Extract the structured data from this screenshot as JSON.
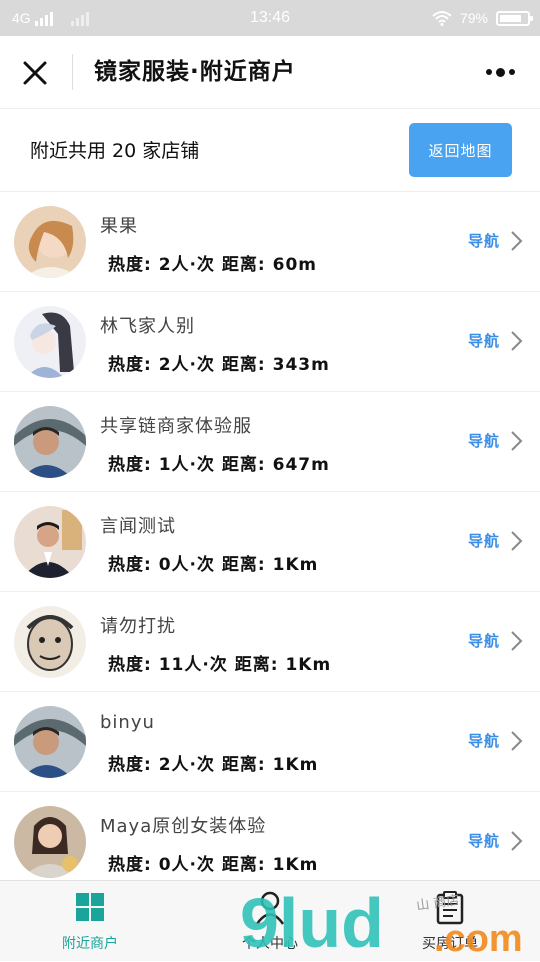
{
  "status_bar": {
    "network": "4G",
    "time": "13:46",
    "battery": "79%",
    "battery_level": 0.79
  },
  "nav": {
    "title": "镜家服装·附近商户"
  },
  "summary": {
    "text": "附近共用 20 家店铺",
    "back_button": "返回地图"
  },
  "merchants": [
    {
      "name": "果果",
      "stats": "热度: 2人·次  距离: 60m",
      "nav_label": "导航",
      "avatar": "avatar-girl"
    },
    {
      "name": "林飞家人别",
      "stats": "热度: 2人·次  距离: 343m",
      "nav_label": "导航",
      "avatar": "avatar-anime"
    },
    {
      "name": "共享链商家体验服",
      "stats": "热度: 1人·次  距离: 647m",
      "nav_label": "导航",
      "avatar": "avatar-man"
    },
    {
      "name": "言闻测试",
      "stats": "热度: 0人·次  距离: 1Km",
      "nav_label": "导航",
      "avatar": "avatar-suit"
    },
    {
      "name": "请勿打扰",
      "stats": "热度: 11人·次  距离: 1Km",
      "nav_label": "导航",
      "avatar": "avatar-cartoon"
    },
    {
      "name": "binyu",
      "stats": "热度: 2人·次  距离: 1Km",
      "nav_label": "导航",
      "avatar": "avatar-man"
    },
    {
      "name": "Maya原创女装体验",
      "stats": "热度: 0人·次  距离: 1Km",
      "nav_label": "导航",
      "avatar": "avatar-woman"
    }
  ],
  "tabs": [
    {
      "label": "附近商户",
      "icon": "grid-icon",
      "active": true
    },
    {
      "label": "个人中心",
      "icon": "person-icon",
      "active": false
    },
    {
      "label": "买房订单",
      "icon": "clipboard-icon",
      "active": false
    }
  ],
  "watermark": {
    "big": "9lud",
    "com": ".com",
    "small": "山 商店"
  },
  "colors": {
    "accent_blue": "#4aa3f0",
    "link_blue": "#3a8ee6",
    "tab_active": "#1aa59b"
  }
}
